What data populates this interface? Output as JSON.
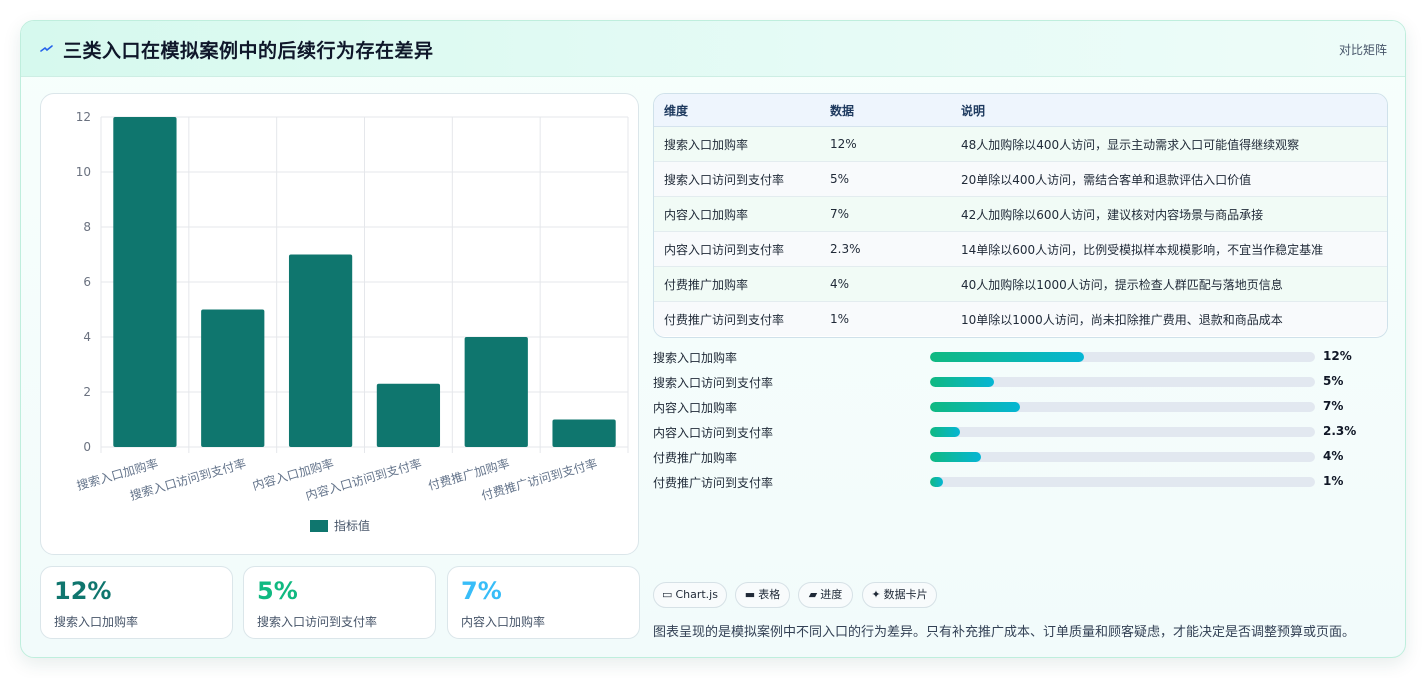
{
  "header": {
    "title": "三类入口在模拟案例中的后续行为存在差异",
    "right_label": "对比矩阵"
  },
  "chart_data": {
    "type": "bar",
    "categories": [
      "搜索入口加购率",
      "搜索入口访问到支付率",
      "内容入口加购率",
      "内容入口访问到支付率",
      "付费推广加购率",
      "付费推广访问到支付率"
    ],
    "series": [
      {
        "name": "指标值",
        "values": [
          12,
          5,
          7,
          2.3,
          4,
          1
        ]
      }
    ],
    "ylim": [
      0,
      12
    ],
    "yticks": [
      "0",
      "2",
      "4",
      "6",
      "8",
      "10",
      "12"
    ],
    "grid": true,
    "legend": "bottom",
    "bar_color": "#0f766e"
  },
  "kpis": [
    {
      "value": "12%",
      "label": "搜索入口加购率",
      "color": "#0f766e"
    },
    {
      "value": "5%",
      "label": "搜索入口访问到支付率",
      "color": "#10b981"
    },
    {
      "value": "7%",
      "label": "内容入口加购率",
      "color": "#38bdf8"
    }
  ],
  "table": {
    "headers": [
      "维度",
      "数据",
      "说明"
    ],
    "rows": [
      [
        "搜索入口加购率",
        "12%",
        "48人加购除以400人访问，显示主动需求入口可能值得继续观察"
      ],
      [
        "搜索入口访问到支付率",
        "5%",
        "20单除以400人访问，需结合客单和退款评估入口价值"
      ],
      [
        "内容入口加购率",
        "7%",
        "42人加购除以600人访问，建议核对内容场景与商品承接"
      ],
      [
        "内容入口访问到支付率",
        "2.3%",
        "14单除以600人访问，比例受模拟样本规模影响，不宜当作稳定基准"
      ],
      [
        "付费推广加购率",
        "4%",
        "40人加购除以1000人访问，提示检查人群匹配与落地页信息"
      ],
      [
        "付费推广访问到支付率",
        "1%",
        "10单除以1000人访问，尚未扣除推广费用、退款和商品成本"
      ]
    ]
  },
  "progress": [
    {
      "label": "搜索入口加购率",
      "value_text": "12%",
      "percent": 12
    },
    {
      "label": "搜索入口访问到支付率",
      "value_text": "5%",
      "percent": 5
    },
    {
      "label": "内容入口加购率",
      "value_text": "7%",
      "percent": 7
    },
    {
      "label": "内容入口访问到支付率",
      "value_text": "2.3%",
      "percent": 2.3
    },
    {
      "label": "付费推广加购率",
      "value_text": "4%",
      "percent": 4
    },
    {
      "label": "付费推广访问到支付率",
      "value_text": "1%",
      "percent": 1
    }
  ],
  "progress_max": 30,
  "tags": [
    {
      "icon": "▭",
      "icon_name": "chart-icon",
      "label": "Chart.js"
    },
    {
      "icon": "▬",
      "icon_name": "table-icon",
      "label": "表格"
    },
    {
      "icon": "▰",
      "icon_name": "progress-icon",
      "label": "进度"
    },
    {
      "icon": "✦",
      "icon_name": "sparkle-icon",
      "label": "数据卡片"
    }
  ],
  "footnote": "图表呈现的是模拟案例中不同入口的行为差异。只有补充推广成本、订单质量和顾客疑虑，才能决定是否调整预算或页面。"
}
